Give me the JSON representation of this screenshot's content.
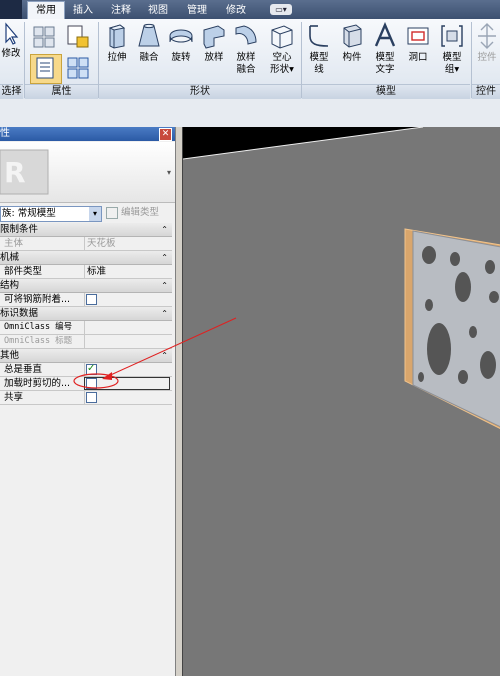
{
  "tabs": [
    {
      "label": "常用",
      "active": true
    },
    {
      "label": "插入",
      "active": false
    },
    {
      "label": "注释",
      "active": false
    },
    {
      "label": "视图",
      "active": false
    },
    {
      "label": "管理",
      "active": false
    },
    {
      "label": "修改",
      "active": false
    }
  ],
  "ribbon": {
    "select": {
      "modify_label": "修改",
      "group_label": "选择"
    },
    "properties": {
      "group_label": "属性"
    },
    "shapes": {
      "group_label": "形状",
      "buttons": [
        {
          "label": "拉伸",
          "label2": ""
        },
        {
          "label": "融合",
          "label2": ""
        },
        {
          "label": "旋转",
          "label2": ""
        },
        {
          "label": "放样",
          "label2": ""
        },
        {
          "label": "放样",
          "label2": "融合"
        },
        {
          "label": "空心",
          "label2": "形状"
        }
      ]
    },
    "model": {
      "group_label": "模型",
      "buttons": [
        {
          "label": "模型",
          "label2": "线"
        },
        {
          "label": "构件",
          "label2": ""
        },
        {
          "label": "模型",
          "label2": "文字"
        },
        {
          "label": "洞口",
          "label2": ""
        },
        {
          "label": "模型",
          "label2": "组"
        }
      ]
    },
    "control": {
      "button_label": "控件",
      "group_label": "控件"
    }
  },
  "properties_panel": {
    "title": "性",
    "type_selector": "族: 常规模型",
    "edit_type_label": "编辑类型",
    "categories": [
      {
        "label": "限制条件",
        "rows": [
          {
            "key": "主体",
            "value": "天花板",
            "dim": true
          }
        ]
      },
      {
        "label": "机械",
        "rows": [
          {
            "key": "部件类型",
            "value": "标准",
            "dim": false
          }
        ]
      },
      {
        "label": "结构",
        "rows": [
          {
            "key": "可将钢筋附着...",
            "checkbox": false
          }
        ]
      },
      {
        "label": "标识数据",
        "rows": [
          {
            "key": "OmniClass 编号",
            "value": "",
            "mono": true
          },
          {
            "key": "OmniClass 标题",
            "value": "",
            "mono": true,
            "dim": true
          }
        ]
      },
      {
        "label": "其他",
        "rows": [
          {
            "key": "总是垂直",
            "checkbox": true
          },
          {
            "key": "加载时剪切的...",
            "checkbox": false
          },
          {
            "key": "共享",
            "checkbox": false
          }
        ]
      }
    ]
  },
  "colors": {
    "accent": "#2b5aa5",
    "annotation": "#e02020",
    "viewport": "#777777"
  }
}
